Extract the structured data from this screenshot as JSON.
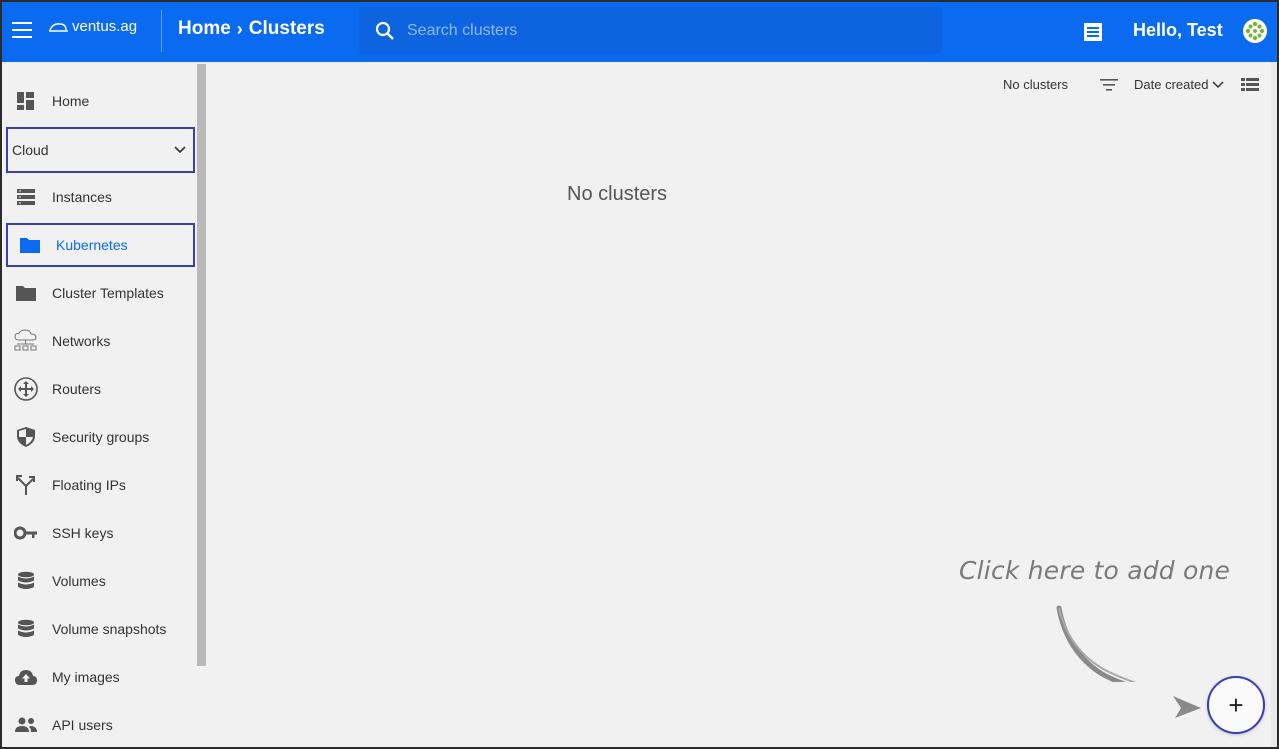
{
  "header": {
    "logo_text": "ventus.ag",
    "breadcrumb": {
      "home": "Home",
      "separator": "›",
      "current": "Clusters"
    },
    "search_placeholder": "Search clusters",
    "greeting": "Hello, Test",
    "brand_color": "#0a6af0"
  },
  "sidebar": {
    "home_label": "Home",
    "section_label": "Cloud",
    "items": [
      {
        "label": "Instances",
        "icon": "server-list-icon"
      },
      {
        "label": "Kubernetes",
        "icon": "folder-icon"
      },
      {
        "label": "Cluster Templates",
        "icon": "folder-icon"
      },
      {
        "label": "Networks",
        "icon": "cloud-network-icon"
      },
      {
        "label": "Routers",
        "icon": "router-icon"
      },
      {
        "label": "Security groups",
        "icon": "shield-icon"
      },
      {
        "label": "Floating IPs",
        "icon": "fork-icon"
      },
      {
        "label": "SSH keys",
        "icon": "key-icon"
      },
      {
        "label": "Volumes",
        "icon": "database-icon"
      },
      {
        "label": "Volume snapshots",
        "icon": "database-icon"
      },
      {
        "label": "My images",
        "icon": "cloud-upload-icon"
      },
      {
        "label": "API users",
        "icon": "people-icon"
      }
    ],
    "active_item": "Kubernetes"
  },
  "toolbar": {
    "count_label": "No clusters",
    "sort_label": "Date created"
  },
  "main": {
    "empty_text": "No clusters",
    "hint_text": "Click here to add one",
    "add_button": "+"
  }
}
